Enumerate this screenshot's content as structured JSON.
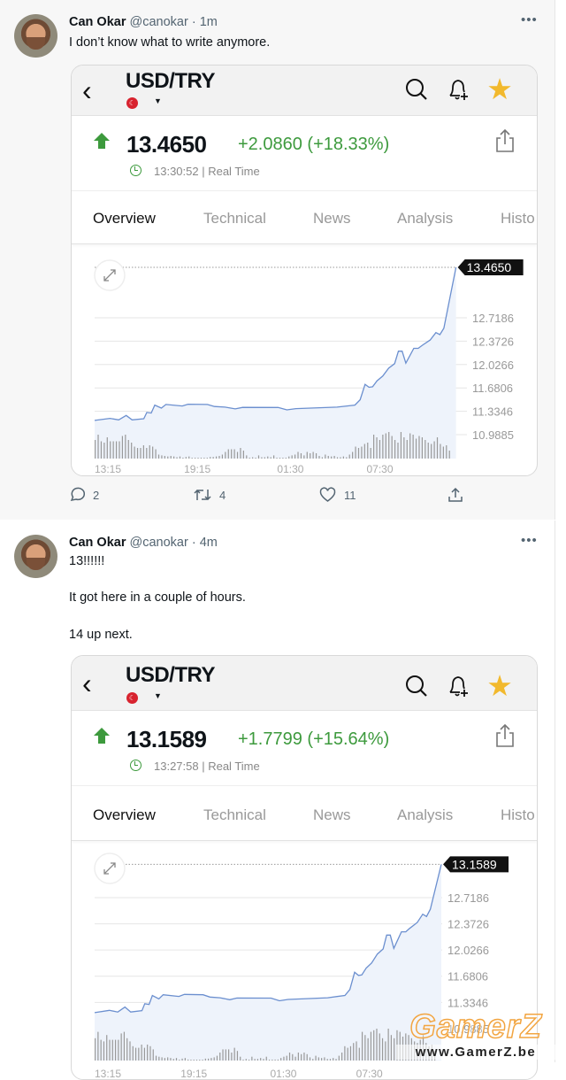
{
  "tweets": [
    {
      "author_name": "Can Okar",
      "handle": "@canokar",
      "time": "· 1m",
      "text_lines": [
        "I don’t know what to write anymore."
      ],
      "actions": {
        "replies": "2",
        "retweets": "4",
        "likes": "11"
      },
      "quote": {
        "symbol": "USD/TRY",
        "flag": "TR",
        "price": "13.4650",
        "change": "+2.0860 (+18.33%)",
        "timestamp": "13:30:52 | Real Time",
        "tabs": [
          "Overview",
          "Technical",
          "News",
          "Analysis",
          "Histo"
        ],
        "active_tab": "Overview"
      }
    },
    {
      "author_name": "Can Okar",
      "handle": "@canokar",
      "time": "· 4m",
      "text_lines": [
        "13!!!!!!",
        "It got here in a couple of hours.",
        "14 up next."
      ],
      "quote": {
        "symbol": "USD/TRY",
        "flag": "TR",
        "price": "13.1589",
        "change": "+1.7799 (+15.64%)",
        "timestamp": "13:27:58 | Real Time",
        "tabs": [
          "Overview",
          "Technical",
          "News",
          "Analysis",
          "Histo"
        ],
        "active_tab": "Overview"
      }
    }
  ],
  "colors": {
    "up": "#3d9a3d",
    "star": "#f2b92d",
    "line": "#6b8fcf",
    "flag": "#d8232f"
  },
  "watermark": {
    "logo": "GamerZ",
    "url": "www.GamerZ.be"
  },
  "chart_data": [
    {
      "type": "line",
      "title": "",
      "last_price_label": "13.4650",
      "y_ticks": [
        "12.7186",
        "12.3726",
        "12.0266",
        "11.6806",
        "11.3346",
        "10.9885"
      ],
      "x_ticks": [
        "13:15",
        "19:15",
        "01:30",
        "07:30"
      ],
      "grid": true,
      "series": [
        [
          "13:15",
          11.199
        ],
        [
          "14:17",
          11.23
        ],
        [
          "14:52",
          11.207
        ],
        [
          "15:22",
          11.273
        ],
        [
          "15:46",
          11.207
        ],
        [
          "16:33",
          11.225
        ],
        [
          "16:45",
          11.317
        ],
        [
          "17:03",
          11.308
        ],
        [
          "17:17",
          11.426
        ],
        [
          "17:44",
          11.382
        ],
        [
          "18:02",
          11.435
        ],
        [
          "19:08",
          11.413
        ],
        [
          "19:31",
          11.44
        ],
        [
          "20:49",
          11.435
        ],
        [
          "21:18",
          11.405
        ],
        [
          "22:00",
          11.396
        ],
        [
          "22:41",
          11.37
        ],
        [
          "23:11",
          11.392
        ],
        [
          "01:34",
          11.391
        ],
        [
          "02:09",
          11.356
        ],
        [
          "02:45",
          11.374
        ],
        [
          "05:31",
          11.396
        ],
        [
          "06:43",
          11.426
        ],
        [
          "07:04",
          11.505
        ],
        [
          "07:24",
          11.733
        ],
        [
          "07:40",
          11.69
        ],
        [
          "07:54",
          11.698
        ],
        [
          "08:12",
          11.786
        ],
        [
          "08:35",
          11.856
        ],
        [
          "08:59",
          11.974
        ],
        [
          "09:23",
          12.04
        ],
        [
          "09:38",
          12.224
        ],
        [
          "09:53",
          12.224
        ],
        [
          "10:08",
          12.048
        ],
        [
          "10:40",
          12.267
        ],
        [
          "10:58",
          12.267
        ],
        [
          "11:14",
          12.311
        ],
        [
          "11:46",
          12.39
        ],
        [
          "12:09",
          12.5
        ],
        [
          "12:25",
          12.469
        ],
        [
          "12:41",
          12.565
        ],
        [
          "13:30",
          13.465
        ]
      ],
      "volume": [
        70,
        90,
        65,
        60,
        80,
        65,
        65,
        65,
        65,
        85,
        90,
        70,
        60,
        45,
        40,
        40,
        50,
        40,
        50,
        45,
        35,
        15,
        12,
        10,
        8,
        10,
        8,
        5,
        8,
        0,
        6,
        8,
        3,
        0,
        0,
        0,
        0,
        0,
        6,
        6,
        8,
        10,
        15,
        25,
        35,
        35,
        35,
        25,
        40,
        30,
        12,
        0,
        5,
        0,
        12,
        5,
        5,
        8,
        5,
        12,
        0,
        3,
        3,
        3,
        8,
        12,
        15,
        25,
        20,
        12,
        25,
        20,
        25,
        20,
        10,
        5,
        15,
        10,
        8,
        10,
        5,
        5,
        8,
        5,
        15,
        25,
        45,
        40,
        45,
        55,
        60,
        40,
        90,
        80,
        70,
        90,
        95,
        100,
        85,
        70,
        60,
        100,
        80,
        70,
        95,
        90,
        75,
        85,
        80,
        70,
        60,
        55,
        65,
        80,
        55,
        45,
        50,
        30
      ]
    },
    {
      "type": "line",
      "title": "",
      "last_price_label": "13.1589",
      "y_ticks": [
        "12.7186",
        "12.3726",
        "12.0266",
        "11.6806",
        "11.3346",
        "10.9885"
      ],
      "x_ticks": [
        "13:15",
        "19:15",
        "01:30",
        "07:30"
      ],
      "grid": true,
      "series": [
        [
          "13:15",
          11.199
        ],
        [
          "14:17",
          11.23
        ],
        [
          "14:52",
          11.207
        ],
        [
          "15:22",
          11.273
        ],
        [
          "15:46",
          11.207
        ],
        [
          "16:33",
          11.225
        ],
        [
          "16:45",
          11.317
        ],
        [
          "17:03",
          11.308
        ],
        [
          "17:17",
          11.426
        ],
        [
          "17:44",
          11.382
        ],
        [
          "18:02",
          11.435
        ],
        [
          "19:08",
          11.413
        ],
        [
          "19:31",
          11.44
        ],
        [
          "20:49",
          11.435
        ],
        [
          "21:18",
          11.405
        ],
        [
          "22:00",
          11.396
        ],
        [
          "22:41",
          11.37
        ],
        [
          "23:11",
          11.392
        ],
        [
          "01:34",
          11.391
        ],
        [
          "02:09",
          11.356
        ],
        [
          "02:45",
          11.374
        ],
        [
          "05:31",
          11.396
        ],
        [
          "06:43",
          11.426
        ],
        [
          "07:04",
          11.505
        ],
        [
          "07:24",
          11.733
        ],
        [
          "07:40",
          11.69
        ],
        [
          "07:54",
          11.698
        ],
        [
          "08:12",
          11.786
        ],
        [
          "08:35",
          11.856
        ],
        [
          "08:59",
          11.974
        ],
        [
          "09:23",
          12.04
        ],
        [
          "09:38",
          12.224
        ],
        [
          "09:53",
          12.224
        ],
        [
          "10:08",
          12.048
        ],
        [
          "10:40",
          12.267
        ],
        [
          "10:58",
          12.267
        ],
        [
          "11:14",
          12.311
        ],
        [
          "11:46",
          12.39
        ],
        [
          "12:09",
          12.5
        ],
        [
          "12:25",
          12.469
        ],
        [
          "12:41",
          12.565
        ],
        [
          "13:27",
          13.1589
        ]
      ],
      "volume": [
        70,
        90,
        65,
        60,
        80,
        65,
        65,
        65,
        65,
        85,
        90,
        70,
        60,
        45,
        40,
        40,
        50,
        40,
        50,
        45,
        35,
        15,
        12,
        10,
        8,
        10,
        8,
        5,
        8,
        0,
        6,
        8,
        3,
        0,
        0,
        0,
        0,
        0,
        6,
        6,
        8,
        10,
        15,
        25,
        35,
        35,
        35,
        25,
        40,
        30,
        12,
        0,
        5,
        0,
        12,
        5,
        5,
        8,
        5,
        12,
        0,
        3,
        3,
        3,
        8,
        12,
        15,
        25,
        20,
        12,
        25,
        20,
        25,
        20,
        10,
        5,
        15,
        10,
        8,
        10,
        5,
        5,
        8,
        5,
        15,
        25,
        45,
        40,
        45,
        55,
        60,
        40,
        90,
        80,
        70,
        90,
        95,
        100,
        85,
        70,
        60,
        100,
        80,
        70,
        95,
        90,
        75,
        85,
        80,
        70,
        60,
        55,
        65,
        80,
        55,
        45,
        50,
        30
      ]
    }
  ]
}
